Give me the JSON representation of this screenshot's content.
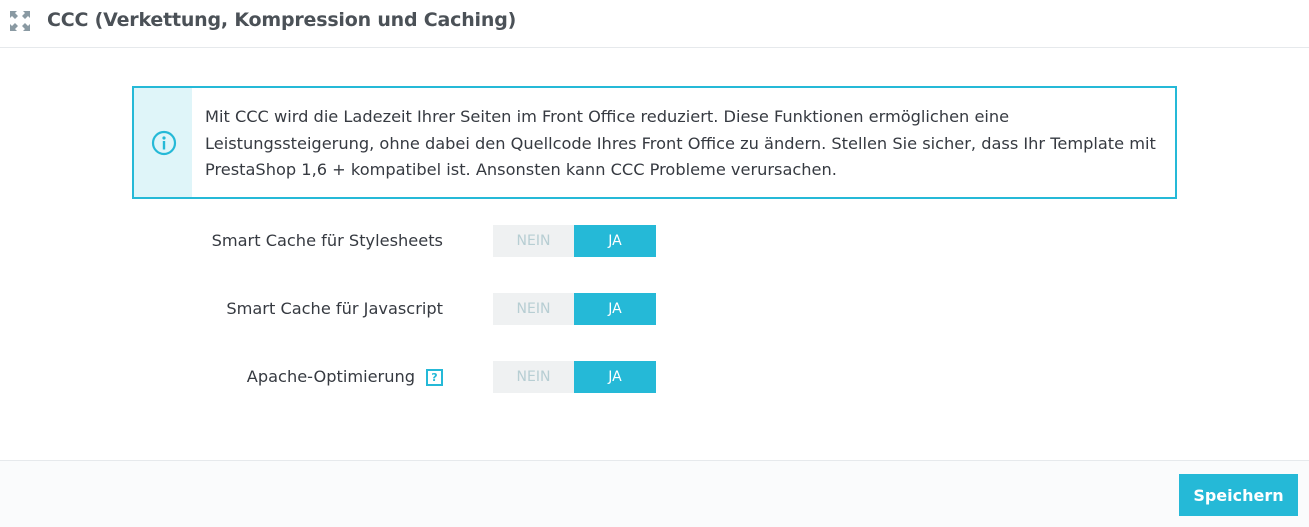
{
  "panel": {
    "title": "CCC (Verkettung, Kompression und Caching)",
    "expand_icon": "expand-arrows-icon"
  },
  "alert": {
    "icon": "info-icon",
    "lines": [
      "Mit CCC wird die Ladezeit Ihrer Seiten im Front Office reduziert. Diese Funktionen ermöglichen eine",
      "Leistungssteigerung, ohne dabei den Quellcode Ihres Front Office zu ändern. Stellen Sie sicher, dass Ihr Template mit",
      "PrestaShop 1,6 + kompatibel ist. Ansonsten kann CCC Probleme verursachen."
    ]
  },
  "settings": [
    {
      "label": "Smart Cache für Stylesheets",
      "off_label": "NEIN",
      "on_label": "JA",
      "value": "JA"
    },
    {
      "label": "Smart Cache für Javascript",
      "off_label": "NEIN",
      "on_label": "JA",
      "value": "JA"
    },
    {
      "label": "Apache-Optimierung",
      "help": "?",
      "off_label": "NEIN",
      "on_label": "JA",
      "value": "JA"
    }
  ],
  "footer": {
    "save_label": "Speichern"
  },
  "colors": {
    "accent": "#25b9d7",
    "alert_bg": "#dff5f9",
    "switch_off_bg": "#eff1f2",
    "switch_off_text": "#b7ced3",
    "text": "#363a41"
  }
}
